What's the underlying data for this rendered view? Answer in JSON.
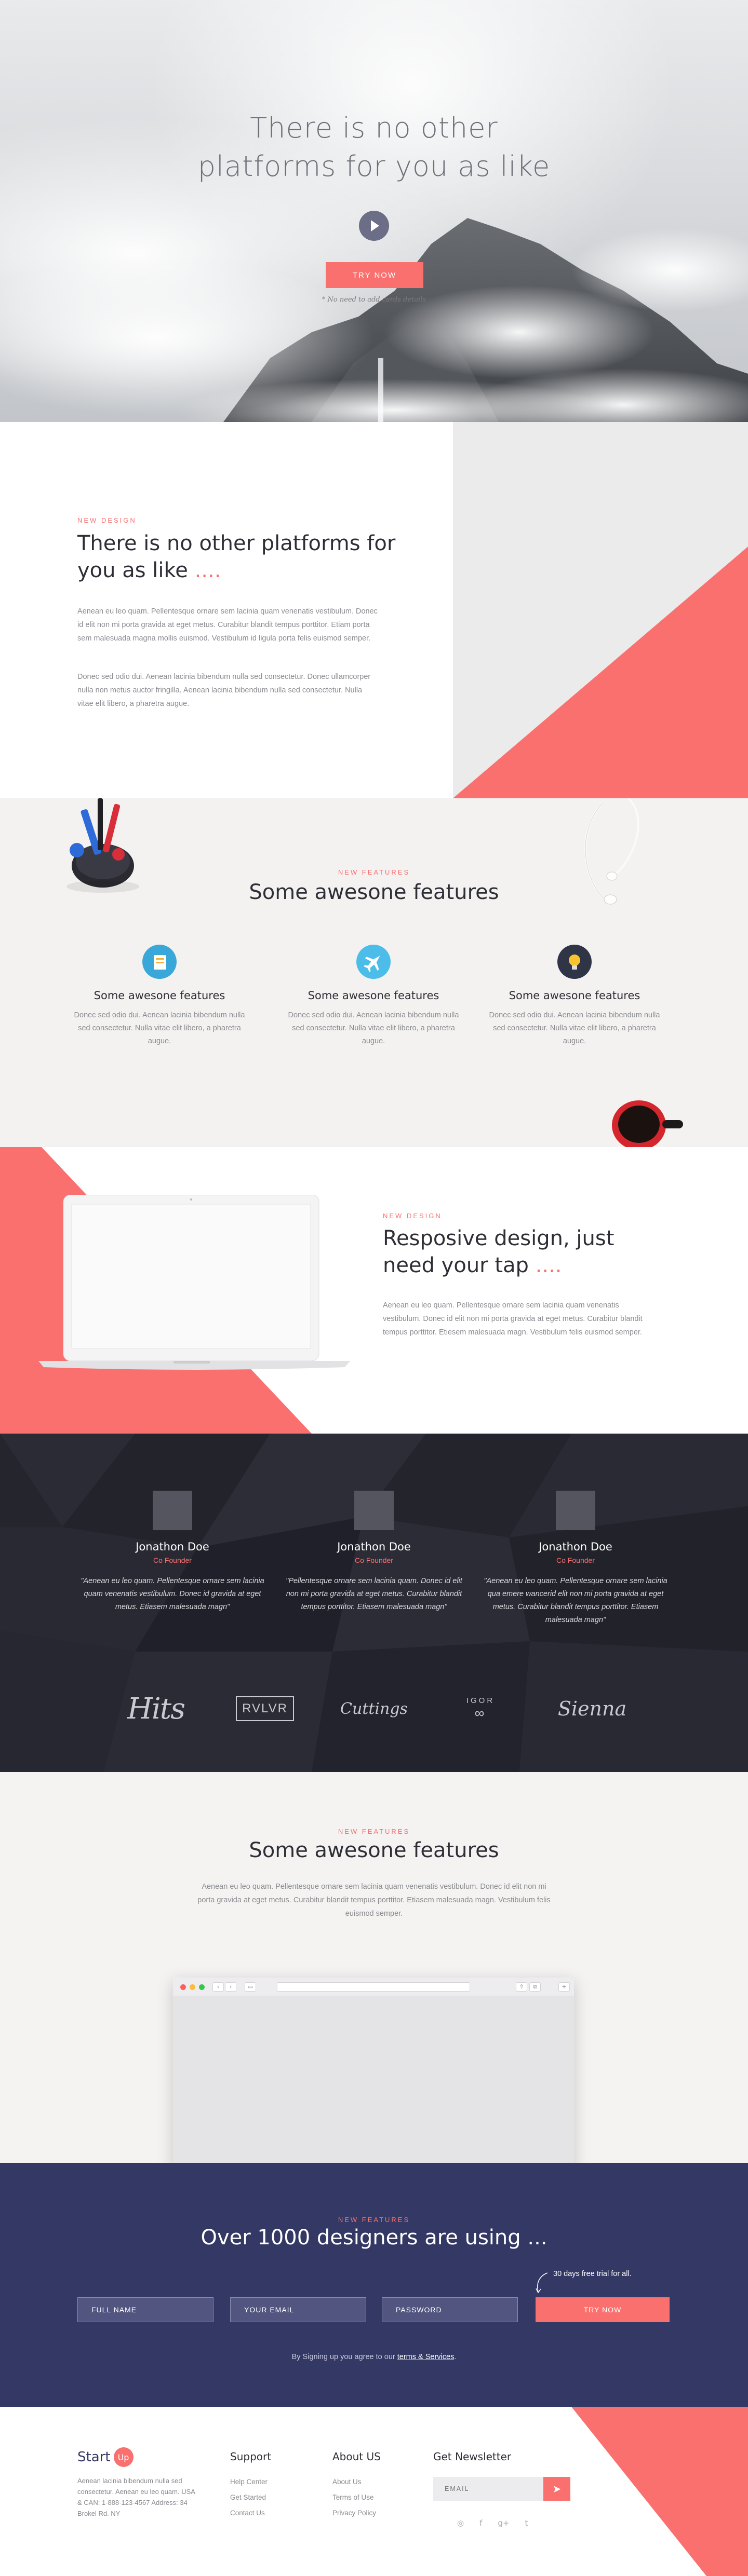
{
  "hero": {
    "title_line1": "There is no other",
    "title_line2": "platforms for you as like",
    "cta_label": "TRY NOW",
    "note": "* No need to add cards details"
  },
  "design1": {
    "kicker": "NEW DESIGN",
    "title": "There is no other platforms for you as like",
    "dots": "....",
    "p1": "Aenean eu leo quam. Pellentesque ornare sem lacinia quam venenatis vestibulum. Donec id elit non mi porta gravida at eget metus. Curabitur blandit tempus porttitor. Etiam porta sem malesuada magna mollis euismod. Vestibulum id ligula porta felis euismod semper.",
    "p2": "Donec sed odio dui. Aenean lacinia bibendum nulla sed consectetur. Donec ullamcorper nulla non metus auctor fringilla. Aenean lacinia bibendum nulla sed consectetur. Nulla vitae elit libero, a pharetra augue."
  },
  "features": {
    "kicker": "NEW FEATURES",
    "title": "Some awesone features",
    "items": [
      {
        "title": "Some awesone features",
        "desc": "Donec sed odio dui. Aenean lacinia bibendum nulla sed consectetur. Nulla vitae elit libero, a pharetra augue.",
        "icon": "book-icon",
        "color": "#39a8d8"
      },
      {
        "title": "Some awesone features",
        "desc": "Donec sed odio dui. Aenean lacinia bibendum nulla sed consectetur. Nulla vitae elit libero, a pharetra augue.",
        "icon": "airplane-icon",
        "color": "#4cbde8"
      },
      {
        "title": "Some awesone features",
        "desc": "Donec sed odio dui. Aenean lacinia bibendum nulla sed consectetur. Nulla vitae elit libero, a pharetra augue.",
        "icon": "lightbulb-icon",
        "color": "#2f3447"
      }
    ]
  },
  "responsive": {
    "kicker": "NEW DESIGN",
    "title": "Resposive design, just need your tap",
    "dots": "....",
    "body": "Aenean eu leo quam. Pellentesque ornare sem lacinia quam venenatis vestibulum. Donec id elit non mi porta gravida at eget metus. Curabitur blandit tempus porttitor. Etiesem malesuada magn. Vestibulum felis euismod semper."
  },
  "testimonials": {
    "items": [
      {
        "name": "Jonathon Doe",
        "role": "Co Founder",
        "quote": "\"Aenean eu leo quam. Pellentesque ornare sem lacinia quam venenatis vestibulum. Donec id gravida at eget metus. Etiasem malesuada magn\""
      },
      {
        "name": "Jonathon Doe",
        "role": "Co Founder",
        "quote": "\"Pellentesque ornare sem lacinia quam. Donec id elit non mi porta gravida at eget metus. Curabitur blandit tempus porttitor. Etiasem malesuada magn\""
      },
      {
        "name": "Jonathon Doe",
        "role": "Co Founder",
        "quote": "\"Aenean eu leo quam. Pellentesque ornare sem lacinia qua emere wancerid elit non mi porta gravida at eget metus. Curabitur blandit tempus porttitor. Etiasem malesuada magn\""
      }
    ],
    "logos": {
      "hits": "Hits",
      "rvlvr": "RVLVR",
      "cuttings": "Cuttings",
      "igor": "IGOR",
      "igor_mark": "∞",
      "sienna": "Sienna"
    }
  },
  "browser": {
    "kicker": "NEW FEATURES",
    "title": "Some awesone features",
    "body": "Aenean eu leo quam. Pellentesque ornare sem lacinia quam venenatis vestibulum. Donec id elit non mi porta gravida at eget metus. Curabitur blandit tempus porttitor. Etiasem malesuada magn. Vestibulum felis euismod semper."
  },
  "signup": {
    "kicker": "NEW FEATURES",
    "title": "Over 1000 designers are using ...",
    "trial": "30 days free trial for all.",
    "fullname_placeholder": "FULL NAME",
    "email_placeholder": "YOUR EMAIL",
    "password_placeholder": "PASSWORD",
    "button_label": "TRY NOW",
    "legal_prefix": "By Signing up you agree to our",
    "legal_link": "terms & Services",
    "legal_suffix": "."
  },
  "footer": {
    "brand": "Start",
    "brand_mark": "Up",
    "about": "Aenean lacinia bibendum nulla sed consectetur. Aenean eu leo quam. USA & CAN: 1-888-123-4567 Address: 34 Brokel Rd. NY",
    "col1": {
      "title": "Support",
      "links": [
        "Help Center",
        "Get Started",
        "Contact Us"
      ]
    },
    "col2": {
      "title": "About US",
      "links": [
        "About Us",
        "Terms of Use",
        "Privacy Policy"
      ]
    },
    "col3": {
      "title": "Get Newsletter"
    },
    "email_placeholder": "EMAIL",
    "social": [
      "◎",
      "f",
      "g+",
      "t"
    ]
  },
  "colors": {
    "accent": "#f9706f",
    "navy": "#343864",
    "dark": "#25252e"
  }
}
